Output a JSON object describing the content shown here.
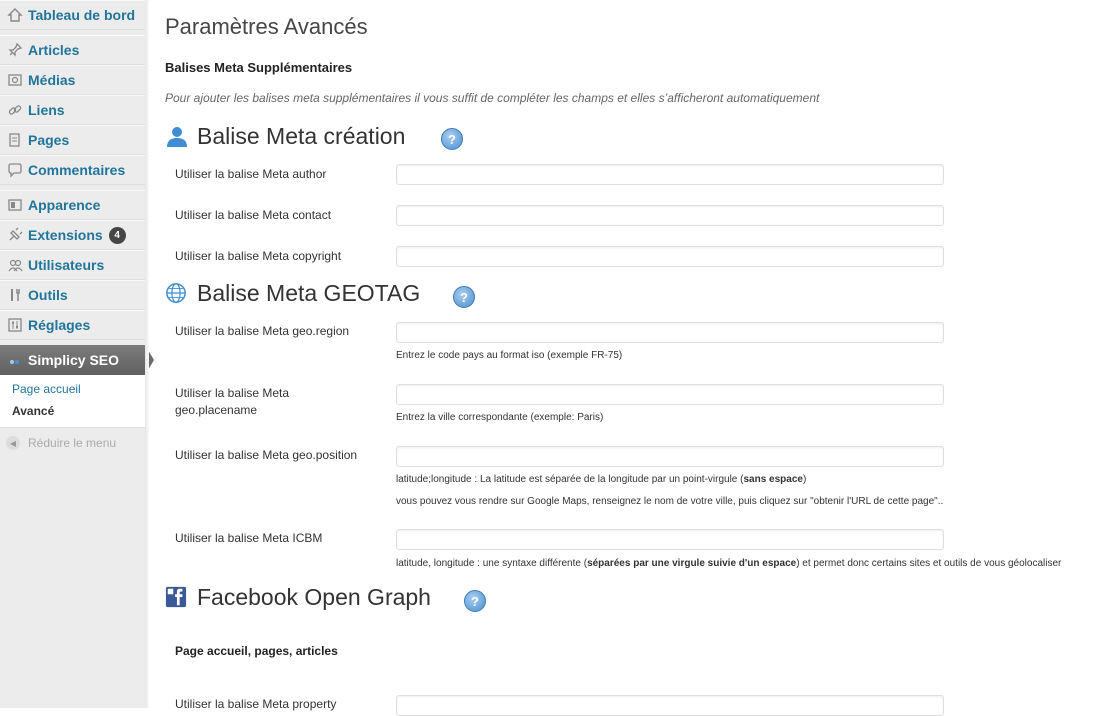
{
  "sidebar": {
    "items": [
      {
        "label": "Tableau de bord",
        "icon": "dashboard-icon"
      },
      {
        "label": "Articles",
        "icon": "pin-icon"
      },
      {
        "label": "Médias",
        "icon": "media-icon"
      },
      {
        "label": "Liens",
        "icon": "link-icon"
      },
      {
        "label": "Pages",
        "icon": "pages-icon"
      },
      {
        "label": "Commentaires",
        "icon": "comment-icon"
      },
      {
        "label": "Apparence",
        "icon": "appearance-icon"
      },
      {
        "label": "Extensions",
        "icon": "plugin-icon",
        "badge": "4"
      },
      {
        "label": "Utilisateurs",
        "icon": "users-icon"
      },
      {
        "label": "Outils",
        "icon": "tools-icon"
      },
      {
        "label": "Réglages",
        "icon": "settings-icon"
      }
    ],
    "active": {
      "label": "Simplicy SEO"
    },
    "submenu": [
      {
        "label": "Page accueil"
      },
      {
        "label": "Avancé"
      }
    ],
    "collapse_label": "Réduire le menu"
  },
  "main": {
    "title": "Paramètres Avancés",
    "subsection": "Balises Meta Supplémentaires",
    "intro": "Pour ajouter les balises meta supplémentaires il vous suffit de compléter les champs et elles s’afficheront automatiquement",
    "sections": {
      "creation": {
        "title": "Balise Meta création",
        "fields": [
          {
            "label": "Utiliser la balise Meta author",
            "value": ""
          },
          {
            "label": "Utiliser la balise Meta contact",
            "value": ""
          },
          {
            "label": "Utiliser la balise Meta copyright",
            "value": ""
          }
        ]
      },
      "geotag": {
        "title": "Balise Meta GEOTAG",
        "fields": [
          {
            "label": "Utiliser la balise Meta geo.region",
            "value": "",
            "hint": "Entrez le code pays au format iso (exemple FR-75)"
          },
          {
            "label": "Utiliser la balise Meta geo.placename",
            "value": "",
            "hint": "Entrez la ville correspondante (exemple: Paris)"
          },
          {
            "label": "Utiliser la balise Meta geo.position",
            "value": "",
            "hint_pre": "latitude;longitude : La latitude est séparée de la longitude par un point-virgule (",
            "hint_bold": "sans espace",
            "hint_post": ")",
            "hint2": "vous pouvez vous rendre sur Google Maps, renseignez le nom de votre ville, puis cliquez sur \"obtenir l'URL de cette page\".."
          },
          {
            "label": "Utiliser la balise Meta ICBM",
            "value": "",
            "hint_pre": "latitude, longitude : une syntaxe différente (",
            "hint_bold": "séparées par une virgule suivie d'un espace",
            "hint_post": ") et permet donc certains sites et outils de vous géolocaliser"
          }
        ]
      },
      "facebook": {
        "title": "Facebook Open Graph",
        "subtitle": "Page accueil, pages, articles",
        "fields": [
          {
            "label": "Utiliser la balise Meta property",
            "value": ""
          }
        ]
      }
    },
    "help_glyph": "?"
  },
  "colors": {
    "link": "#21759b",
    "sidebar_bg": "#ececec",
    "active_menu": "#6b6b6b",
    "help_icon": "#4b8fd0",
    "badge": "#464646"
  }
}
